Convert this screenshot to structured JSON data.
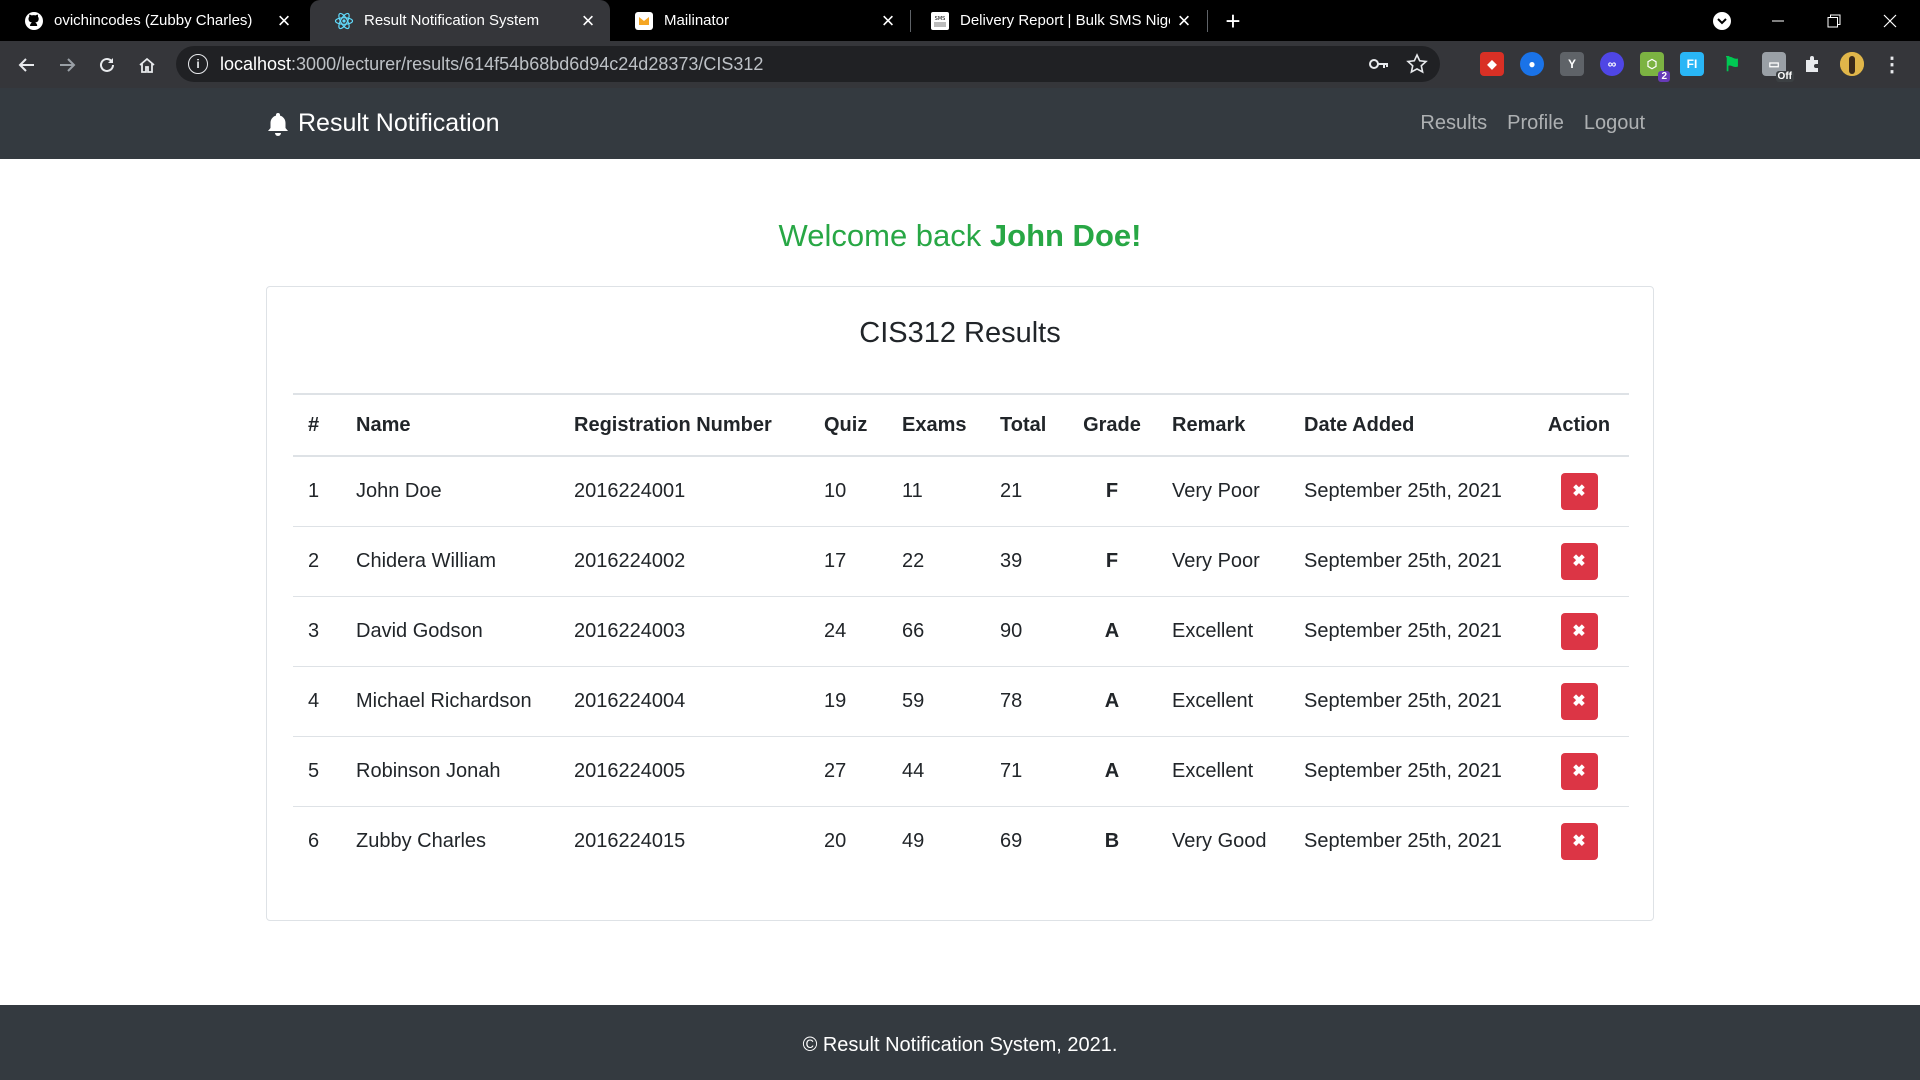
{
  "browser": {
    "tabs": [
      {
        "title": "ovichincodes (Zubby Charles)",
        "icon": "github-icon"
      },
      {
        "title": "Result Notification System",
        "icon": "react-icon",
        "active": true
      },
      {
        "title": "Mailinator",
        "icon": "mailinator-icon"
      },
      {
        "title": "Delivery Report | Bulk SMS Nigeria",
        "icon": "sms-icon"
      }
    ],
    "address": {
      "host": "localhost",
      "path": ":3000/lecturer/results/614f54b68bd6d94c24d28373/CIS312"
    },
    "extensions": [
      {
        "icon": "ext-red-icon",
        "color": "#d93025"
      },
      {
        "icon": "ext-globe-icon",
        "color": "#1a73e8"
      },
      {
        "icon": "ext-y-icon",
        "color": "#5f6368"
      },
      {
        "icon": "ext-blue-icon",
        "color": "#4f46e5"
      },
      {
        "icon": "ext-green-icon",
        "color": "#7cb342",
        "badge": "2"
      },
      {
        "icon": "ext-fi-icon",
        "color": "#29b6f6",
        "label": "FI"
      },
      {
        "icon": "ext-pin-icon",
        "color": "#00c853"
      },
      {
        "icon": "ext-off-icon",
        "color": "#9aa0a6",
        "badge": "Off"
      },
      {
        "icon": "extensions-puzzle-icon",
        "color": "#e8eaed"
      },
      {
        "icon": "profile-avatar-icon",
        "color": "#c9a227"
      }
    ]
  },
  "app": {
    "brand": "Result Notification",
    "nav": {
      "results": "Results",
      "profile": "Profile",
      "logout": "Logout"
    },
    "welcome_prefix": "Welcome back ",
    "welcome_name": "John Doe!",
    "card_title": "CIS312 Results",
    "table": {
      "headers": [
        "#",
        "Name",
        "Registration Number",
        "Quiz",
        "Exams",
        "Total",
        "Grade",
        "Remark",
        "Date Added",
        "Action"
      ],
      "rows": [
        {
          "num": "1",
          "name": "John Doe",
          "reg": "2016224001",
          "quiz": "10",
          "exams": "11",
          "total": "21",
          "grade": "F",
          "remark": "Very Poor",
          "date": "September 25th, 2021"
        },
        {
          "num": "2",
          "name": "Chidera William",
          "reg": "2016224002",
          "quiz": "17",
          "exams": "22",
          "total": "39",
          "grade": "F",
          "remark": "Very Poor",
          "date": "September 25th, 2021"
        },
        {
          "num": "3",
          "name": "David Godson",
          "reg": "2016224003",
          "quiz": "24",
          "exams": "66",
          "total": "90",
          "grade": "A",
          "remark": "Excellent",
          "date": "September 25th, 2021"
        },
        {
          "num": "4",
          "name": "Michael Richardson",
          "reg": "2016224004",
          "quiz": "19",
          "exams": "59",
          "total": "78",
          "grade": "A",
          "remark": "Excellent",
          "date": "September 25th, 2021"
        },
        {
          "num": "5",
          "name": "Robinson Jonah",
          "reg": "2016224005",
          "quiz": "27",
          "exams": "44",
          "total": "71",
          "grade": "A",
          "remark": "Excellent",
          "date": "September 25th, 2021"
        },
        {
          "num": "6",
          "name": "Zubby Charles",
          "reg": "2016224015",
          "quiz": "20",
          "exams": "49",
          "total": "69",
          "grade": "B",
          "remark": "Very Good",
          "date": "September 25th, 2021"
        }
      ]
    },
    "footer": "© Result Notification System, 2021."
  },
  "colors": {
    "navbar": "#343a40",
    "success": "#28a745",
    "danger": "#dc3545",
    "browser_dark": "#35363a"
  }
}
